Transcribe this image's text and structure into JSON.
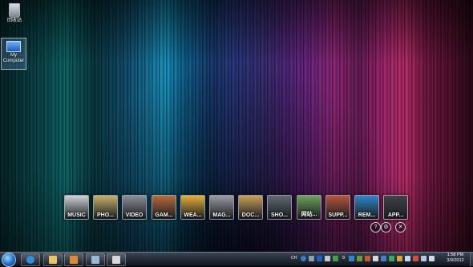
{
  "desktop": {
    "icons": [
      {
        "label": "回收站"
      },
      {
        "label": "My Computer"
      }
    ]
  },
  "dock": {
    "tiles": [
      {
        "label": "MUSIC",
        "icon": "music-icon",
        "color": "#cfd2d6"
      },
      {
        "label": "PHO...",
        "icon": "photo-icon",
        "color": "#c7b16b"
      },
      {
        "label": "VIDEO",
        "icon": "video-icon",
        "color": "#8a8f96"
      },
      {
        "label": "GAM...",
        "icon": "game-icon",
        "color": "#b86a3c"
      },
      {
        "label": "WEA...",
        "icon": "weather-icon",
        "color": "#e6b03a"
      },
      {
        "label": "MAG...",
        "icon": "magazine-icon",
        "color": "#9a9da2"
      },
      {
        "label": "DOC...",
        "icon": "document-icon",
        "color": "#c9a05a"
      },
      {
        "label": "SHO...",
        "icon": "shop-icon",
        "color": "#5e6a6f"
      },
      {
        "label": "网站...",
        "icon": "globe-icon",
        "color": "#6aa35a"
      },
      {
        "label": "SUPP...",
        "icon": "support-icon",
        "color": "#b5553e"
      },
      {
        "label": "REM...",
        "icon": "remote-icon",
        "color": "#2f86c9"
      },
      {
        "label": "APP...",
        "icon": "add-app-icon",
        "color": "#3f4246"
      }
    ],
    "controls": [
      {
        "name": "help-icon",
        "glyph": "?"
      },
      {
        "name": "gear-icon",
        "glyph": "⚙"
      },
      {
        "name": "close-icon",
        "glyph": "✕"
      }
    ]
  },
  "taskbar": {
    "pinned": [
      {
        "icon": "ie-icon",
        "color": "#2f8fe0"
      },
      {
        "icon": "explorer-icon",
        "color": "#e6c46a"
      },
      {
        "icon": "media-player-icon",
        "color": "#e08a2f"
      },
      {
        "icon": "app-icon",
        "color": "#9ab7d8"
      },
      {
        "icon": "film-icon",
        "color": "#d8d8d8"
      }
    ],
    "tray": {
      "lang": "CH",
      "number": "9"
    },
    "clock": {
      "time": "1:58 PM",
      "date": "3/9/2012"
    }
  }
}
